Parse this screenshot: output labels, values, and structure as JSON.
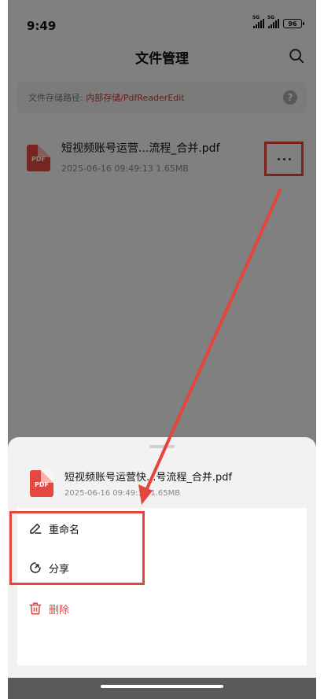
{
  "status_bar": {
    "time": "9:49",
    "signal_1": "5G",
    "signal_2": "5G",
    "battery": "96"
  },
  "header": {
    "title": "文件管理",
    "search_icon": "search-icon"
  },
  "path_bar": {
    "label": "文件存储路径: ",
    "path": "内部存储/PdfReaderEdit",
    "help_icon": "question-icon"
  },
  "file": {
    "icon_label": "PDF",
    "name": "短视频账号运营...流程_合并.pdf",
    "meta": "2025-06-16 09:49:13   1.65MB"
  },
  "sheet": {
    "file_name": "短视频账号运营快...号流程_合并.pdf",
    "file_meta": "2025-06-16 09:49:13   1.65MB",
    "icon_label": "PDF",
    "menu": [
      {
        "label": "重命名",
        "icon": "rename-icon"
      },
      {
        "label": "分享",
        "icon": "share-icon"
      },
      {
        "label": "删除",
        "icon": "trash-icon"
      }
    ]
  },
  "colors": {
    "accent_red": "#e5453b",
    "path_red": "#c23b3b"
  }
}
